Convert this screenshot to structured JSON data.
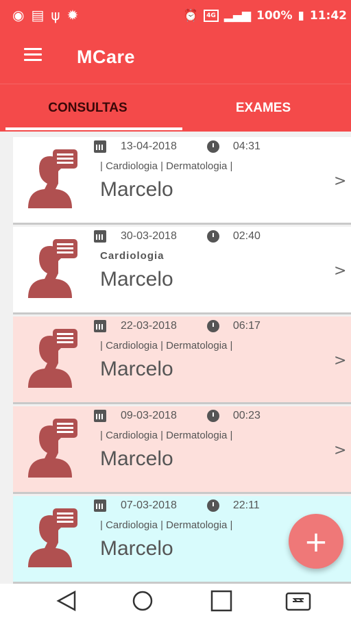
{
  "status_bar": {
    "left_icons": [
      "wifi-icon",
      "message-icon",
      "usb-icon",
      "android-debug-icon"
    ],
    "alarm_icon": "alarm-icon",
    "network_badge": "4G",
    "battery": "100%",
    "time": "11:42"
  },
  "app_bar": {
    "title": "MCare",
    "menu_icon": "hamburger-menu-icon"
  },
  "tabs": [
    {
      "label": "CONSULTAS",
      "selected": true
    },
    {
      "label": "EXAMES",
      "selected": false
    }
  ],
  "consultations": [
    {
      "date": "13-04-2018",
      "time": "04:31",
      "specialties": "| Cardiologia | Dermatologia |",
      "name": "Marcelo",
      "bg": "#ffffff"
    },
    {
      "date": "30-03-2018",
      "time": "02:40",
      "specialties": "Cardiologia",
      "name": "Marcelo",
      "bg": "#ffffff"
    },
    {
      "date": "22-03-2018",
      "time": "06:17",
      "specialties": "| Cardiologia | Dermatologia |",
      "name": "Marcelo",
      "bg": "#fde0dc"
    },
    {
      "date": "09-03-2018",
      "time": "00:23",
      "specialties": "| Cardiologia | Dermatologia |",
      "name": "Marcelo",
      "bg": "#fde0dc"
    },
    {
      "date": "07-03-2018",
      "time": "22:11",
      "specialties": "| Cardiologia | Dermatologia |",
      "name": "Marcelo",
      "bg": "#d8fbfc"
    }
  ],
  "fab": {
    "label": "+"
  },
  "colors": {
    "primary": "#f44a4a",
    "fab": "#ef7878",
    "avatar": "#b05050"
  },
  "nav_bar": {
    "buttons": [
      "back-icon",
      "home-icon",
      "recents-icon",
      "rotate-icon"
    ]
  }
}
